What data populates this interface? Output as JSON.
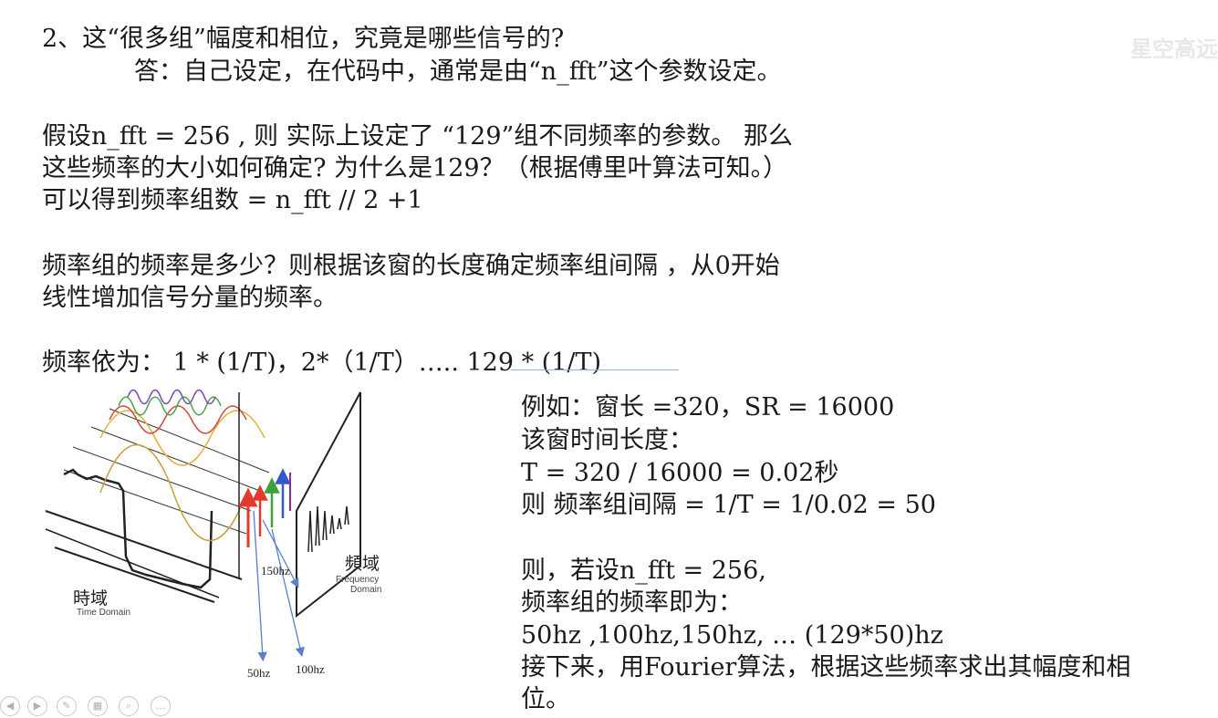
{
  "watermark": "星空高远",
  "lines": {
    "l1": "2、这“很多组”幅度和相位，究竟是哪些信号的?",
    "l2": "答：自己设定，在代码中，通常是由“n_fft”这个参数设定。",
    "l3": "假设n_fft = 256 , 则 实际上设定了 “129”组不同频率的参数。 那么",
    "l4": "这些频率的大小如何确定? 为什么是129？（根据傅里叶算法可知。）",
    "l5": "可以得到频率组数 = n_fft // 2  +1",
    "l6": "频率组的频率是多少？则根据该窗的长度确定频率组间隔 ，从0开始",
    "l7": "线性增加信号分量的频率。",
    "l8": "频率依为：  1 * (1/T)，2*（1/T）….. 129 * (1/T)"
  },
  "example": {
    "e1": "例如：窗长 =320，SR = 16000",
    "e2": "该窗时间长度：",
    "e3": "T = 320 / 16000 = 0.02秒",
    "e4": "则 频率组间隔 = 1/T = 1/0.02 = 50",
    "e5": "则，若设n_fft = 256,",
    "e6": "频率组的频率即为：",
    "e7": "50hz ,100hz,150hz, … (129*50)hz",
    "e8": "接下来，用Fourier算法，根据这些频率求出其幅度和相",
    "e9": "位。"
  },
  "diagram": {
    "time_cn": "時域",
    "time_en": "Time Domain",
    "freq_cn": "頻域",
    "freq_en1": "Frequency",
    "freq_en2": "Domain",
    "f150": "150hz",
    "f50": "50hz",
    "f100": "100hz"
  },
  "toolbar": [
    "prev",
    "next",
    "pen",
    "slides",
    "zoom",
    "more"
  ],
  "colors": {
    "red": "#e23b2e",
    "green": "#3aa33a",
    "blue": "#3557c7",
    "purple": "#8a2b9a",
    "arrow": "#5b7fc9",
    "underline": "#8fb2d9"
  }
}
